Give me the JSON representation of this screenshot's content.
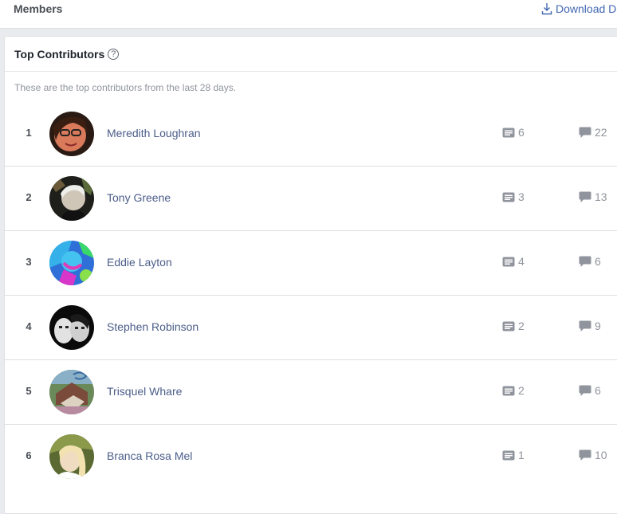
{
  "header": {
    "title": "Members",
    "download_label": "Download D"
  },
  "card": {
    "title": "Top Contributors",
    "help_glyph": "?",
    "subtitle": "These are the top contributors from the last 28 days."
  },
  "contributors": [
    {
      "rank": "1",
      "name": "Meredith Loughran",
      "posts": "6",
      "comments": "22"
    },
    {
      "rank": "2",
      "name": "Tony Greene",
      "posts": "3",
      "comments": "13"
    },
    {
      "rank": "3",
      "name": "Eddie Layton",
      "posts": "4",
      "comments": "6"
    },
    {
      "rank": "4",
      "name": "Stephen Robinson",
      "posts": "2",
      "comments": "9"
    },
    {
      "rank": "5",
      "name": "Trisquel Whare",
      "posts": "2",
      "comments": "6"
    },
    {
      "rank": "6",
      "name": "Branca Rosa Mel",
      "posts": "1",
      "comments": "10"
    }
  ],
  "colors": {
    "link": "#4267b2",
    "name": "#4b5d89",
    "muted": "#90949c",
    "border": "#dddfe2",
    "background": "#e9ebee"
  },
  "icons": {
    "download": "download-icon",
    "help": "help-icon",
    "posts": "post-icon",
    "comments": "comment-icon"
  }
}
